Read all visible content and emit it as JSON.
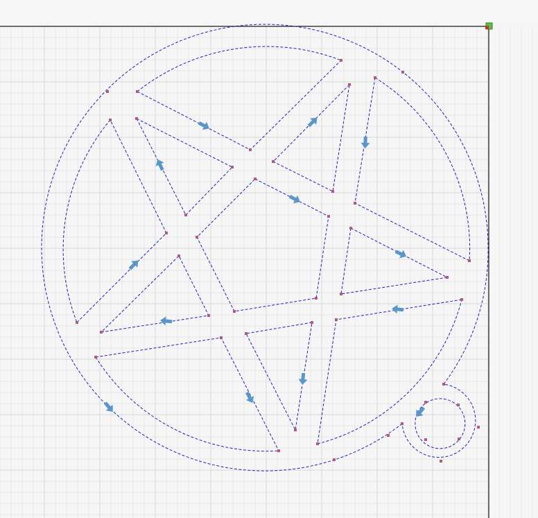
{
  "colors": {
    "background": "#f6f6f6",
    "grid_minor": "#e6e6e6",
    "grid_major": "#d6d6d6",
    "border": "#1a1a1a",
    "cut_path": "#1f1fb8",
    "node": "#b05a82",
    "direction_arrow": "#5a96c8",
    "origin_square_fill": "#5fbf4a",
    "origin_square_stroke": "#2f7f25",
    "origin_marker": "#c0392b"
  },
  "icons": {
    "origin": "origin-marker-icon",
    "direction": "direction-arrow-icon"
  },
  "paths": {
    "outer_circle": {
      "points": []
    },
    "tab_outer_arc": {
      "points": []
    },
    "inner_circle_arc": {
      "points": []
    },
    "star_triangle_top": {
      "points": []
    }
  }
}
